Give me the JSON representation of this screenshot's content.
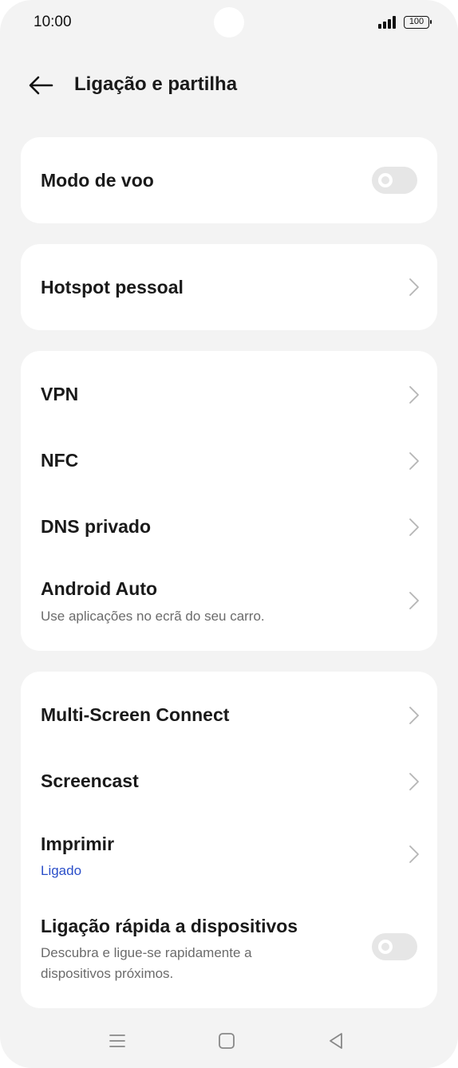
{
  "status_bar": {
    "time": "10:00",
    "battery": "100"
  },
  "header": {
    "title": "Ligação e partilha"
  },
  "settings": {
    "airplane_mode": {
      "label": "Modo de voo",
      "enabled": false
    },
    "hotspot": {
      "label": "Hotspot pessoal"
    },
    "vpn": {
      "label": "VPN"
    },
    "nfc": {
      "label": "NFC"
    },
    "private_dns": {
      "label": "DNS privado"
    },
    "android_auto": {
      "label": "Android Auto",
      "description": "Use aplicações no ecrã do seu carro."
    },
    "multi_screen": {
      "label": "Multi-Screen Connect"
    },
    "screencast": {
      "label": "Screencast"
    },
    "print": {
      "label": "Imprimir",
      "status": "Ligado"
    },
    "quick_device_connect": {
      "label": "Ligação rápida a dispositivos",
      "description_line1": "Descubra e ligue-se rapidamente a",
      "description_line2": "dispositivos próximos.",
      "enabled": false
    }
  },
  "colors": {
    "background": "#f3f3f3",
    "card": "#ffffff",
    "accent_blue": "#2b4fc9",
    "toggle_off": "#e6e6e6"
  },
  "icons": {
    "back": "arrow-left",
    "chevron": "chevron-right",
    "nav_menu": "menu",
    "nav_home": "square",
    "nav_back": "triangle-left"
  }
}
